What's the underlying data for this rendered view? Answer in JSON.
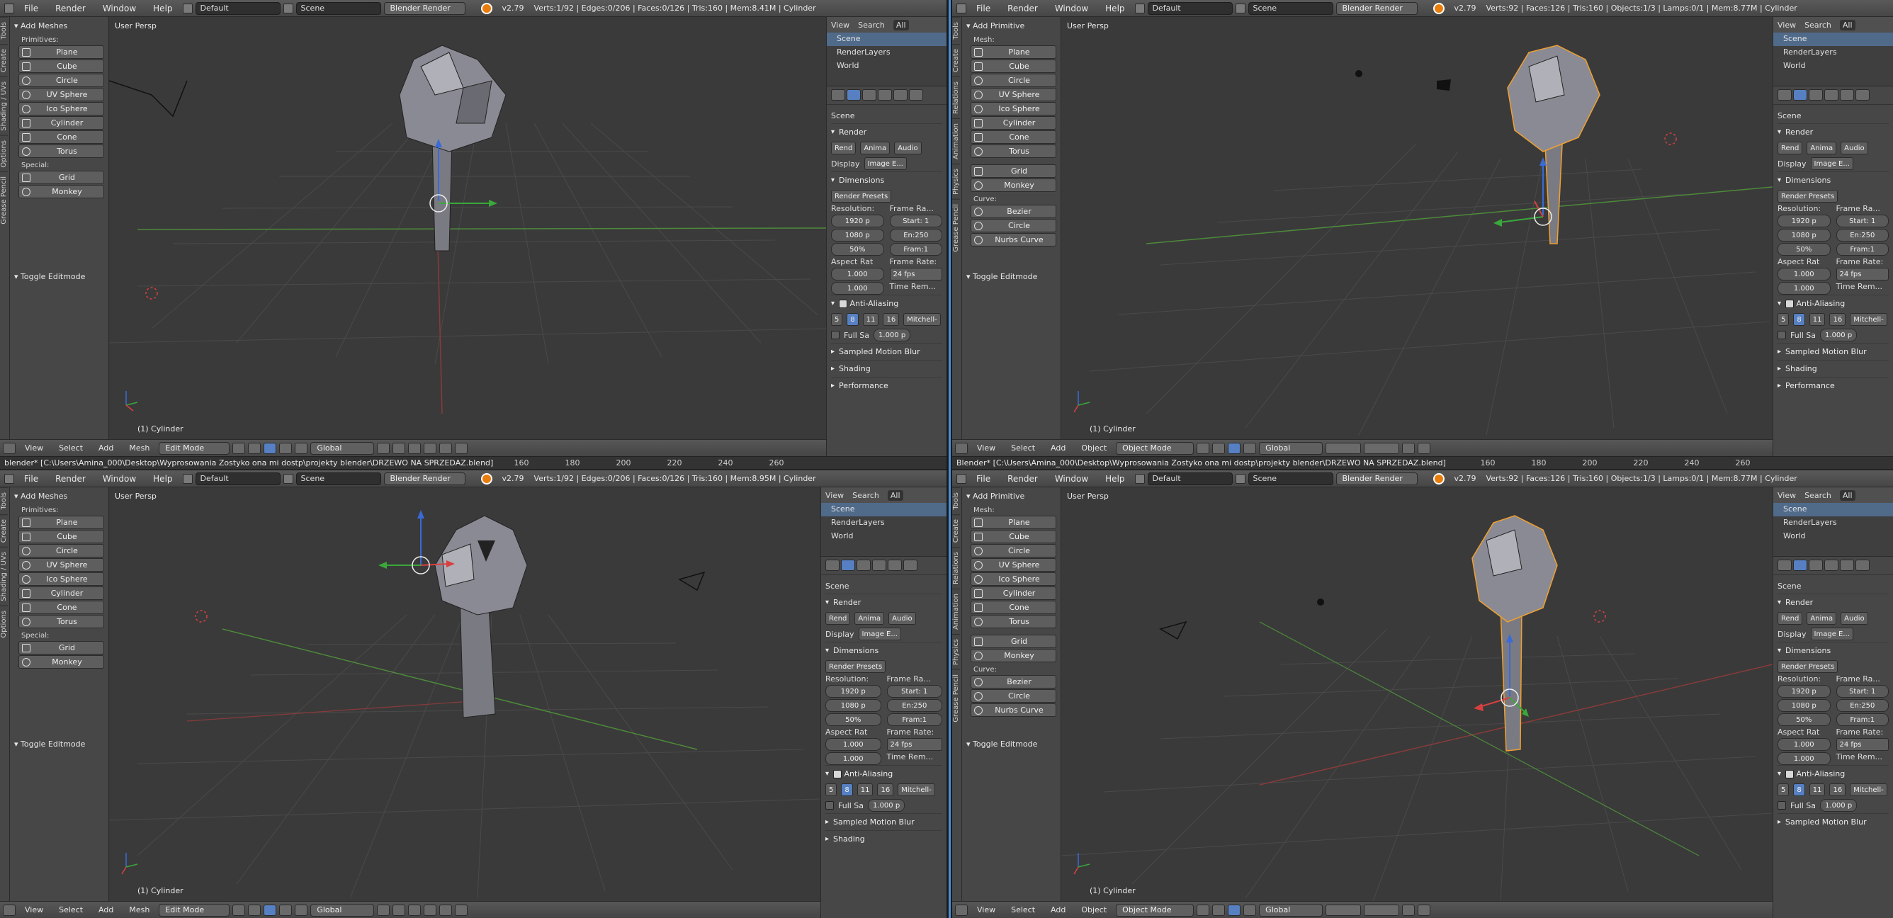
{
  "menus": [
    "File",
    "Render",
    "Window",
    "Help"
  ],
  "layout": "Default",
  "scene": "Scene",
  "engine": "Blender Render",
  "version": "v2.79",
  "stats": {
    "q1": "Verts:1/92 | Edges:0/206 | Faces:0/126 | Tris:160 | Mem:8.41M | Cylinder",
    "q2": "Verts:92 | Faces:126 | Tris:160 | Objects:1/3 | Lamps:0/1 | Mem:8.77M | Cylinder",
    "q3": "Verts:1/92 | Edges:0/206 | Faces:0/126 | Tris:160 | Mem:8.95M | Cylinder",
    "q4": "Verts:92 | Faces:126 | Tris:160 | Objects:1/3 | Lamps:0/1 | Mem:8.77M | Cylinder"
  },
  "vtabs": [
    "Tools",
    "Create",
    "Relations",
    "Animation",
    "Physics",
    "Grease Pencil"
  ],
  "vtabs_edit": [
    "Tools",
    "Create",
    "Shading / UVs",
    "Options",
    "Grease Pencil"
  ],
  "toolshelf": {
    "edit_header": "Add Meshes",
    "object_header": "Add Primitive",
    "mesh_label": "Mesh:",
    "primitives_label": "Primitives:",
    "primitives": [
      "Plane",
      "Cube",
      "Circle",
      "UV Sphere",
      "Ico Sphere",
      "Cylinder",
      "Cone",
      "Torus"
    ],
    "special_label": "Special:",
    "special": [
      "Grid",
      "Monkey"
    ],
    "curve_label": "Curve:",
    "curves": [
      "Bezier",
      "Circle",
      "Nurbs Curve"
    ],
    "toggle": "Toggle Editmode"
  },
  "viewport": {
    "title": "User Persp",
    "object": "(1) Cylinder",
    "menu_edit": [
      "View",
      "Select",
      "Add",
      "Mesh"
    ],
    "menu_object": [
      "View",
      "Select",
      "Add",
      "Object"
    ],
    "mode_edit": "Edit Mode",
    "mode_object": "Object Mode",
    "orientation": "Global"
  },
  "outliner": {
    "menu": [
      "View",
      "Search",
      "All"
    ],
    "rows": [
      "Scene",
      "RenderLayers",
      "World"
    ]
  },
  "properties": {
    "scene_label": "Scene",
    "render_header": "Render",
    "render_buttons": [
      "Rend",
      "Anima",
      "Audio"
    ],
    "display_label": "Display",
    "display_value": "Image E...",
    "dimensions_header": "Dimensions",
    "render_presets": "Render Presets",
    "resolution_label": "Resolution:",
    "res_x": "1920 p",
    "res_y": "1080 p",
    "res_pct": "50%",
    "frame_range_label": "Frame Ra...",
    "start": "Start: 1",
    "end": "En:250",
    "frame_step": "Fram:1",
    "aspect_label": "Aspect Rat",
    "aspect_x": "1.000",
    "aspect_y": "1.000",
    "frame_rate_label": "Frame Rate:",
    "fps": "24 fps",
    "time_remap_label": "Time Rem...",
    "time_remap_value": "1",
    "aa_header": "Anti-Aliasing",
    "aa_samples": [
      "5",
      "8",
      "11",
      "16"
    ],
    "aa_filter": "Mitchell-",
    "full_sample": "Full Sa",
    "filter_size": "1.000 p",
    "motion_blur": "Sampled Motion Blur",
    "shading": "Shading",
    "performance": "Performance"
  },
  "timeline": {
    "path_q1": "blender* [C:\\Users\\Amina_000\\Desktop\\Wyprosowania Zostyko ona mi dostp\\projekty blender\\DRZEWO NA SPRZEDAZ.blend]",
    "path_q2": "Blender* [C:\\Users\\Amina_000\\Desktop\\Wyprosowania Zostyko ona mi dostp\\projekty blender\\DRZEWO NA SPRZEDAZ.blend]",
    "ticks": [
      "160",
      "180",
      "200",
      "220",
      "240",
      "260"
    ]
  },
  "colors": {
    "accent_blue": "#4a8fd8",
    "selection_orange": "#f0a030",
    "grid_red": "#b03030",
    "grid_green": "#30a030"
  }
}
